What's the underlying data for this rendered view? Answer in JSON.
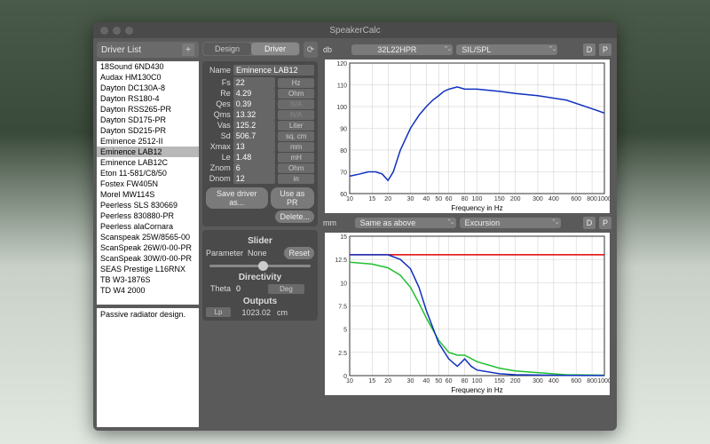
{
  "window": {
    "title": "SpeakerCalc"
  },
  "driverList": {
    "header": "Driver List",
    "items": [
      "18Sound 6ND430",
      "Audax HM130C0",
      "Dayton DC130A-8",
      "Dayton RS180-4",
      "Dayton RSS265-PR",
      "Dayton SD175-PR",
      "Dayton SD215-PR",
      "Eminence 2512-II",
      "Eminence LAB12",
      "Eminence LAB12C",
      "Eton 11-581/C8/50",
      "Fostex FW405N",
      "Morel MW114S",
      "Peerless SLS 830669",
      "Peerless 830880-PR",
      "Peerless alaCornara",
      "Scanspeak 25W/8565-00",
      "ScanSpeak 26W/0-00-PR",
      "ScanSpeak 30W/0-00-PR",
      "SEAS Prestige L16RNX",
      "TB W3-1876S",
      "TD W4 2000"
    ],
    "selectedIndex": 8,
    "note": "Passive radiator design."
  },
  "tabs": {
    "items": [
      "Design",
      "Driver"
    ],
    "activeIndex": 1
  },
  "params": {
    "nameLabel": "Name",
    "nameValue": "Eminence LAB12",
    "rows": [
      {
        "lbl": "Fs",
        "val": "22",
        "unit": "Hz",
        "na": false
      },
      {
        "lbl": "Re",
        "val": "4.29",
        "unit": "Ohm",
        "na": false
      },
      {
        "lbl": "Qes",
        "val": "0.39",
        "unit": "N/A",
        "na": true
      },
      {
        "lbl": "Qms",
        "val": "13.32",
        "unit": "N/A",
        "na": true
      },
      {
        "lbl": "Vas",
        "val": "125.2",
        "unit": "Liter",
        "na": false
      },
      {
        "lbl": "Sd",
        "val": "506.7",
        "unit": "sq. cm",
        "na": false
      },
      {
        "lbl": "Xmax",
        "val": "13",
        "unit": "mm",
        "na": false
      },
      {
        "lbl": "Le",
        "val": "1.48",
        "unit": "mH",
        "na": false
      },
      {
        "lbl": "Znom",
        "val": "6",
        "unit": "Ohm",
        "na": false
      },
      {
        "lbl": "Dnom",
        "val": "12",
        "unit": "in",
        "na": false
      }
    ],
    "saveBtn": "Save driver as...",
    "useBtn": "Use as PR",
    "deleteBtn": "Delete..."
  },
  "slider": {
    "title": "Slider",
    "paramLabel": "Parameter",
    "paramValue": "None",
    "resetBtn": "Reset"
  },
  "directivity": {
    "title": "Directivity",
    "thetaLabel": "Theta",
    "thetaValue": "0",
    "thetaUnit": "Deg"
  },
  "outputs": {
    "title": "Outputs",
    "lpLabel": "Lp",
    "lpValue": "1023.02",
    "lpUnit": "cm"
  },
  "chartTop": {
    "leftDropdown": "32L22HPR",
    "rightDropdown": "SIL/SPL",
    "dBtn": "D",
    "pBtn": "P",
    "yLabel": "db",
    "xLabel": "Frequency in Hz"
  },
  "chartBottom": {
    "leftDropdown": "Same as above",
    "rightDropdown": "Excursion",
    "dBtn": "D",
    "pBtn": "P",
    "yLabel": "mm",
    "xLabel": "Frequency in Hz"
  },
  "chart_data": [
    {
      "type": "line",
      "title": "SIL/SPL",
      "xscale": "log",
      "xlabel": "Frequency in Hz",
      "ylabel": "db",
      "xlim": [
        10,
        1000
      ],
      "ylim": [
        60,
        120
      ],
      "xticks": [
        10,
        15,
        20,
        30,
        40,
        50,
        60,
        80,
        100,
        150,
        200,
        300,
        400,
        600,
        800,
        1000
      ],
      "yticks": [
        60,
        70,
        80,
        90,
        100,
        110,
        120
      ],
      "series": [
        {
          "name": "SPL",
          "color": "#1030c0",
          "x": [
            10,
            12,
            14,
            16,
            18,
            20,
            22,
            25,
            30,
            35,
            40,
            45,
            50,
            55,
            60,
            70,
            80,
            100,
            150,
            200,
            300,
            500,
            800,
            1000
          ],
          "y": [
            68,
            69,
            70,
            70,
            69,
            66,
            70,
            80,
            90,
            96,
            100,
            103,
            105,
            107,
            108,
            109,
            108,
            108,
            107,
            106,
            105,
            103,
            99,
            97
          ]
        }
      ]
    },
    {
      "type": "line",
      "title": "Excursion",
      "xscale": "log",
      "xlabel": "Frequency in Hz",
      "ylabel": "mm",
      "xlim": [
        10,
        1000
      ],
      "ylim": [
        0,
        15
      ],
      "xticks": [
        10,
        15,
        20,
        30,
        40,
        50,
        60,
        80,
        100,
        150,
        200,
        300,
        400,
        600,
        800,
        1000
      ],
      "yticks": [
        0,
        2.5,
        5.0,
        7.5,
        10.0,
        12.5,
        15.0
      ],
      "series": [
        {
          "name": "limit",
          "color": "#e00000",
          "x": [
            10,
            1000
          ],
          "y": [
            13,
            13
          ]
        },
        {
          "name": "green",
          "color": "#20c030",
          "x": [
            10,
            15,
            20,
            25,
            30,
            35,
            40,
            50,
            60,
            70,
            80,
            100,
            150,
            200,
            500,
            1000
          ],
          "y": [
            12.2,
            12,
            11.6,
            10.8,
            9.5,
            7.8,
            6.2,
            3.8,
            2.5,
            2.2,
            2.2,
            1.5,
            0.8,
            0.5,
            0.1,
            0.05
          ]
        },
        {
          "name": "blue",
          "color": "#1030c0",
          "x": [
            10,
            15,
            20,
            25,
            30,
            35,
            40,
            50,
            60,
            70,
            75,
            80,
            90,
            100,
            150,
            200,
            500,
            1000
          ],
          "y": [
            13,
            13,
            13,
            12.5,
            11.5,
            9.5,
            7.0,
            3.5,
            1.8,
            1.0,
            1.4,
            1.8,
            1.0,
            0.6,
            0.2,
            0.1,
            0.02,
            0.01
          ]
        }
      ]
    }
  ]
}
